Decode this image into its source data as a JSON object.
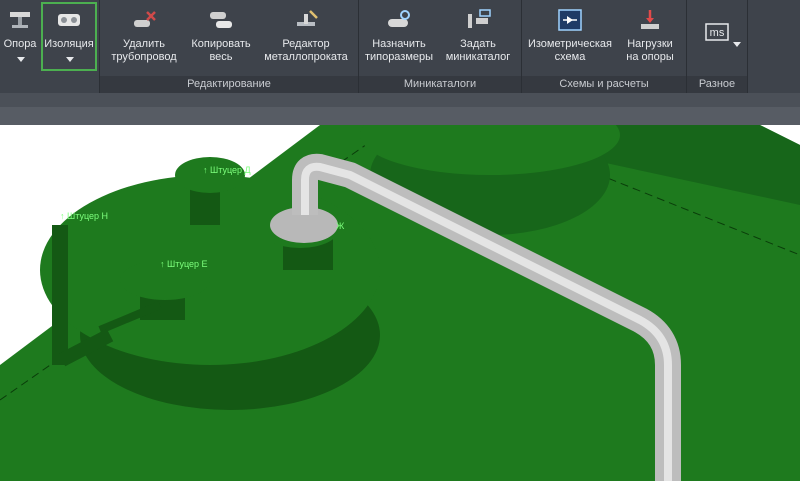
{
  "ribbon": {
    "buttons": [
      {
        "id": "opora",
        "label": "Опора",
        "icon": "support-icon"
      },
      {
        "id": "izolyaciya",
        "label": "Изоляция",
        "icon": "insulation-icon",
        "selected": true
      },
      {
        "id": "udalit",
        "label": "Удалить\nтрубопровод",
        "icon": "delete-pipe-icon"
      },
      {
        "id": "kopirovat",
        "label": "Копировать\nвесь",
        "icon": "copy-all-icon"
      },
      {
        "id": "redaktor",
        "label": "Редактор\nметаллопроката",
        "icon": "metal-editor-icon"
      },
      {
        "id": "naznachit",
        "label": "Назначить\nтипоразмеры",
        "icon": "assign-sizes-icon"
      },
      {
        "id": "zadat",
        "label": "Задать\nминикаталог",
        "icon": "set-minicatalog-icon"
      },
      {
        "id": "izometr",
        "label": "Изометрическая\nсхема",
        "icon": "isometric-scheme-icon"
      },
      {
        "id": "nagruzki",
        "label": "Нагрузки\nна опоры",
        "icon": "support-loads-icon"
      },
      {
        "id": "raznoe",
        "label": "",
        "icon": "ms-icon"
      }
    ],
    "groups": [
      {
        "id": "redakt",
        "title": "Редактирование"
      },
      {
        "id": "mini",
        "title": "Миникаталоги"
      },
      {
        "id": "schemes",
        "title": "Схемы и расчеты"
      },
      {
        "id": "misc",
        "title": "Разное"
      }
    ]
  },
  "viewport": {
    "nozzle_labels": [
      {
        "id": "d",
        "text": "Штуцер Д"
      },
      {
        "id": "n",
        "text": "Штуцер Н"
      },
      {
        "id": "e",
        "text": "Штуцер Е"
      },
      {
        "id": "zh",
        "text": "Ж"
      }
    ],
    "colors": {
      "vessel": "#1e7a1e",
      "pipe": "#c8c8c8",
      "label": "#7dff7d"
    }
  }
}
